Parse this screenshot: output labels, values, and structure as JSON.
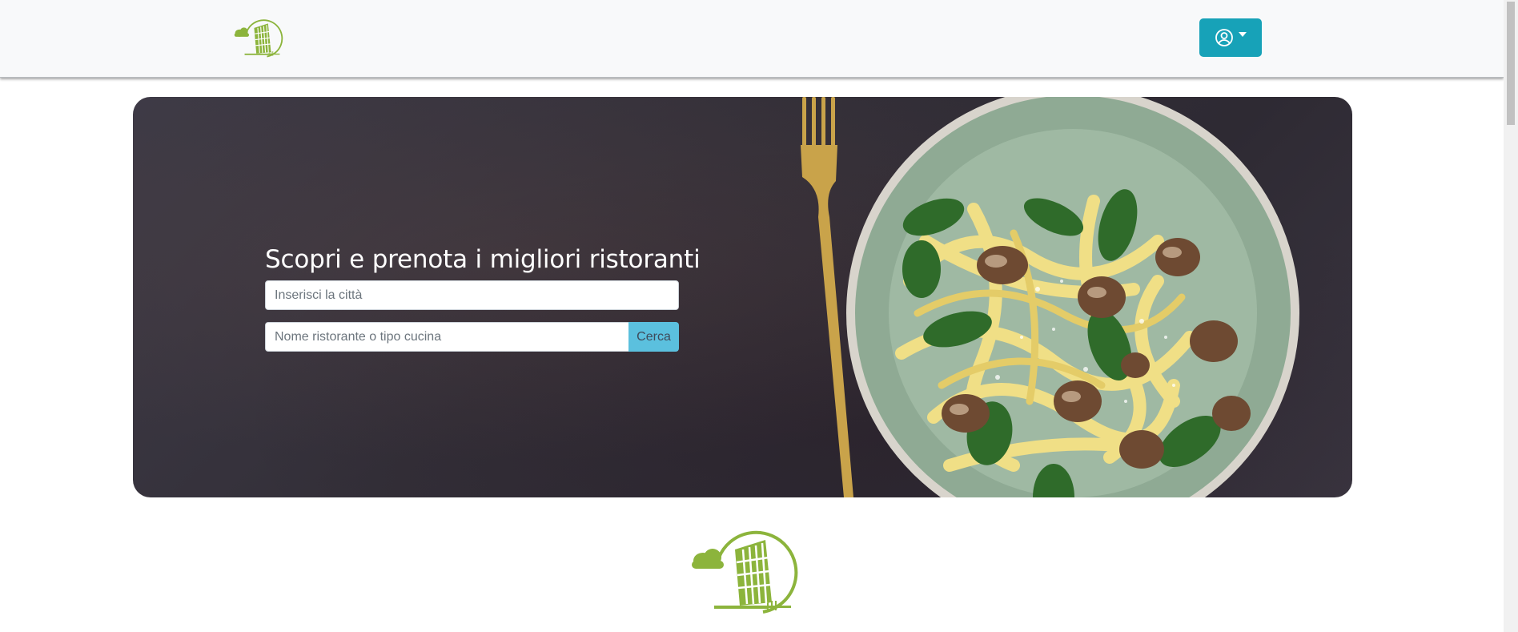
{
  "header": {
    "logo_icon": "leaning-tower-logo-icon",
    "user_menu_icon": "user-circle-icon",
    "accent_color": "#17a2b8",
    "logo_color": "#8cb43c"
  },
  "hero": {
    "title": "Scopri e prenota i migliori ristoranti",
    "city_placeholder": "Inserisci la città",
    "search_placeholder": "Nome ristorante o tipo cucina",
    "search_button_label": "Cerca",
    "search_button_color": "#5bc0de"
  },
  "footer": {
    "logo_icon": "leaning-tower-logo-icon"
  }
}
